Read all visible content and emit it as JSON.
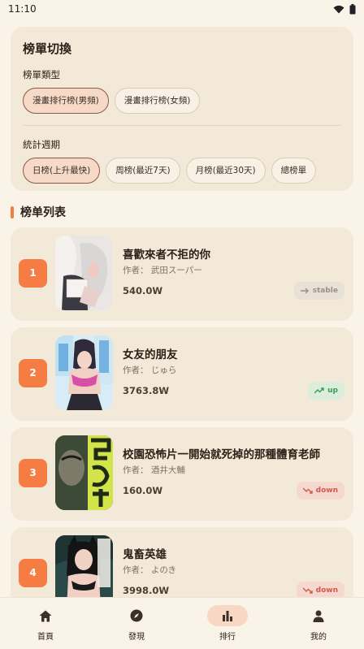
{
  "status": {
    "time": "11:10"
  },
  "switcher": {
    "title": "榜單切換",
    "type_label": "榜單類型",
    "type_options": [
      "漫畫排行榜(男頻)",
      "漫畫排行榜(女頻)"
    ],
    "type_selected": 0,
    "period_label": "統計週期",
    "period_options": [
      "日榜(上升最快)",
      "周榜(最近7天)",
      "月榜(最近30天)",
      "總榜單"
    ],
    "period_selected": 0
  },
  "list": {
    "title": "榜单列表",
    "items": [
      {
        "rank": "1",
        "title": "喜歡來者不拒的你",
        "author": "作者：  武田スーパー",
        "count": "540.0W",
        "trend": "stable"
      },
      {
        "rank": "2",
        "title": "女友的朋友",
        "author": "作者：  じゅら",
        "count": "3763.8W",
        "trend": "up"
      },
      {
        "rank": "3",
        "title": "校園恐怖片一開始就死掉的那種體育老師",
        "author": "作者：  酒井大輔",
        "count": "160.0W",
        "trend": "down"
      },
      {
        "rank": "4",
        "title": "鬼畜英雄",
        "author": "作者：  よのき",
        "count": "3998.0W",
        "trend": "down"
      }
    ]
  },
  "nav": {
    "items": [
      {
        "label": "首頁",
        "icon": "home-icon"
      },
      {
        "label": "發現",
        "icon": "compass-icon"
      },
      {
        "label": "排行",
        "icon": "bar-chart-icon"
      },
      {
        "label": "我的",
        "icon": "person-icon"
      }
    ],
    "active": 2
  },
  "colors": {
    "accent": "#f57c42",
    "background": "#faf3e8",
    "card": "#f3e9d8"
  }
}
